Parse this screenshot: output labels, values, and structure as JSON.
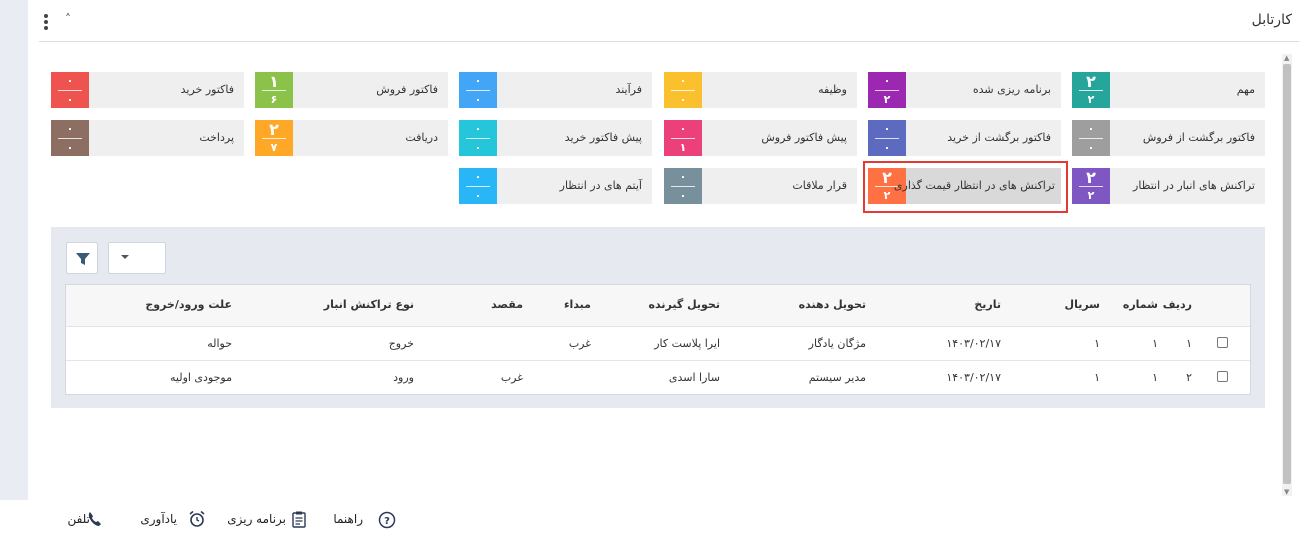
{
  "header": {
    "title": "کارتابل"
  },
  "tiles": [
    {
      "label": "مهم",
      "top": "۲",
      "bottom": "۲",
      "color": "#26a69a"
    },
    {
      "label": "برنامه ریزی شده",
      "top": "۰",
      "bottom": "۲",
      "color": "#9c27b0"
    },
    {
      "label": "وظیفه",
      "top": "۰",
      "bottom": "۰",
      "color": "#fbc02d"
    },
    {
      "label": "فرآیند",
      "top": "۰",
      "bottom": "۰",
      "color": "#42a5f5"
    },
    {
      "label": "فاکتور فروش",
      "top": "۱",
      "bottom": "۶",
      "color": "#8bc34a"
    },
    {
      "label": "فاکتور خرید",
      "top": "۰",
      "bottom": "۰",
      "color": "#ef5350"
    },
    {
      "label": "فاکتور برگشت از فروش",
      "top": "۰",
      "bottom": "۰",
      "color": "#9e9e9e"
    },
    {
      "label": "فاکتور برگشت از خرید",
      "top": "۰",
      "bottom": "۰",
      "color": "#5c6bc0"
    },
    {
      "label": "پیش فاکتور فروش",
      "top": "۰",
      "bottom": "۱",
      "color": "#ec407a"
    },
    {
      "label": "پیش فاکتور خرید",
      "top": "۰",
      "bottom": "۰",
      "color": "#26c6da"
    },
    {
      "label": "دریافت",
      "top": "۲",
      "bottom": "۷",
      "color": "#ffa726"
    },
    {
      "label": "پرداخت",
      "top": "۰",
      "bottom": "۰",
      "color": "#8d6e63"
    },
    {
      "label": "تراکنش های انبار در انتظار",
      "top": "۲",
      "bottom": "۲",
      "color": "#7e57c2"
    },
    {
      "label": "تراکنش های در انتظار قیمت گذاری",
      "top": "۲",
      "bottom": "۲",
      "color": "#ff7043"
    },
    {
      "label": "قرار ملاقات",
      "top": "۰",
      "bottom": "۰",
      "color": "#78909c"
    },
    {
      "label": "آیتم های در انتظار",
      "top": "۰",
      "bottom": "۰",
      "color": "#29b6f6"
    }
  ],
  "table": {
    "headers": {
      "row_no": "ردیف",
      "number": "شماره",
      "serial": "سریال",
      "date": "تاریخ",
      "deliverer": "تحویل دهنده",
      "receiver": "تحویل گیرنده",
      "origin": "مبداء",
      "destination": "مقصد",
      "type": "نوع تراکنش انبار",
      "reason": "علت ورود/خروج"
    },
    "rows": [
      {
        "row_no": "۱",
        "number": "۱",
        "serial": "۱",
        "date": "۱۴۰۳/۰۲/۱۷",
        "deliverer": "مژگان یادگار",
        "receiver": "ایرا پلاست کار",
        "origin": "غرب",
        "destination": "",
        "type": "خروج",
        "reason": "حواله"
      },
      {
        "row_no": "۲",
        "number": "۱",
        "serial": "۱",
        "date": "۱۴۰۳/۰۲/۱۷",
        "deliverer": "مدیر سیستم",
        "receiver": "سارا اسدی",
        "origin": "",
        "destination": "غرب",
        "type": "ورود",
        "reason": "موجودی اولیه"
      }
    ]
  },
  "footer": {
    "help": "راهنما",
    "planning": "برنامه ریزی",
    "reminder": "یادآوری",
    "phone": "تلفن"
  }
}
